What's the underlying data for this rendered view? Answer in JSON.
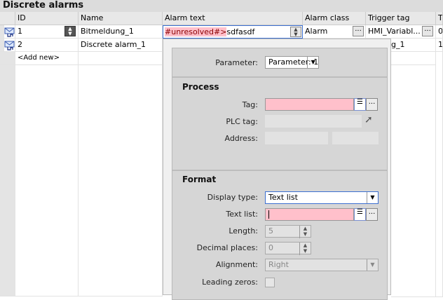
{
  "title": "Discrete alarms",
  "columns": [
    "ID",
    "Name",
    "Alarm text",
    "Alarm class",
    "Trigger tag",
    "T"
  ],
  "rows": [
    {
      "id": "1",
      "name": "Bitmeldung_1",
      "alarm_text_unresolved": "#unresolved#>",
      "alarm_text_rest": "sdfasdf",
      "alarm_class": "Alarm",
      "trigger_tag": "HMI_Variabl...",
      "t": "0"
    },
    {
      "id": "2",
      "name": "Discrete alarm_1",
      "trigger_tag": "g_1",
      "t": "1"
    }
  ],
  "add_new": "<Add new>",
  "ellipsis": "...",
  "popup": {
    "parameter_label": "Parameter:",
    "parameter_value": "Parameter: 1",
    "process": {
      "heading": "Process",
      "tag_label": "Tag:",
      "tag_value": "",
      "plc_tag_label": "PLC tag:",
      "address_label": "Address:"
    },
    "format": {
      "heading": "Format",
      "display_type_label": "Display type:",
      "display_type_value": "Text list",
      "text_list_label": "Text list:",
      "length_label": "Length:",
      "length_value": "5",
      "decimal_label": "Decimal places:",
      "decimal_value": "0",
      "alignment_label": "Alignment:",
      "alignment_value": "Right",
      "leading_zeros_label": "Leading zeros:",
      "leading_zeros_checked": false
    }
  }
}
